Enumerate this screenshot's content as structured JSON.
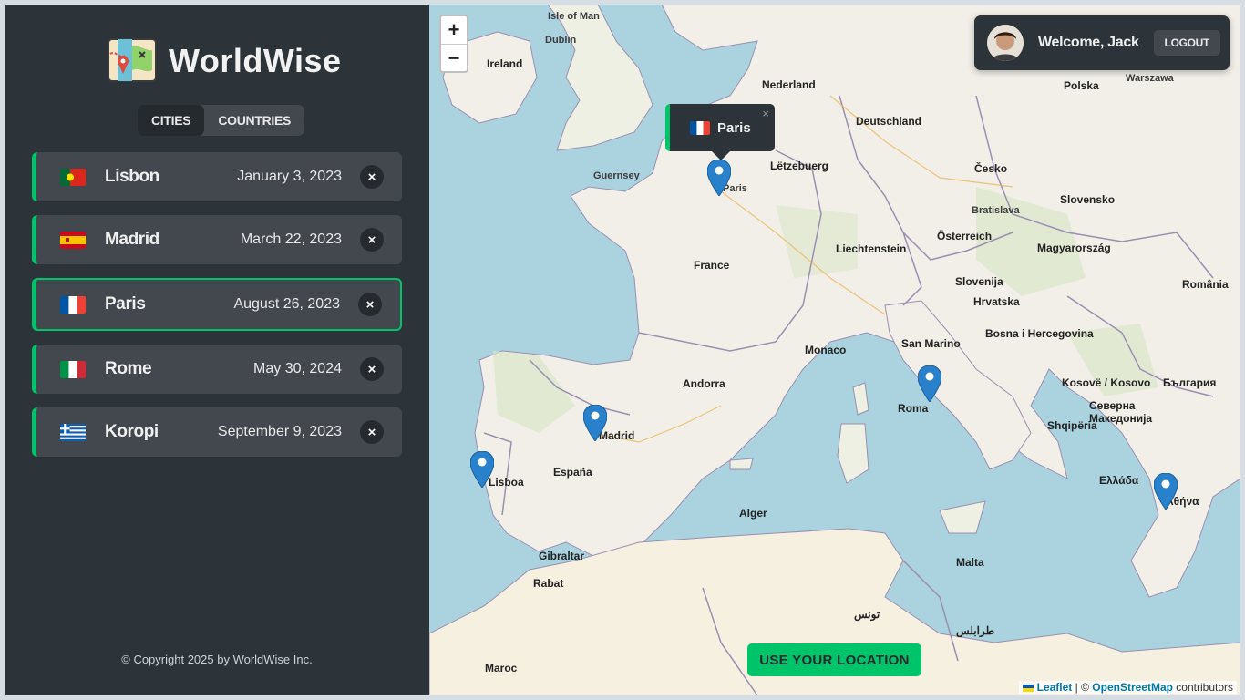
{
  "sidebar": {
    "app_name": "WorldWise",
    "tabs": [
      "CITIES",
      "COUNTRIES"
    ],
    "cities": [
      {
        "name": "Lisbon",
        "date": "January 3, 2023",
        "flag": "portugal",
        "delete": "×"
      },
      {
        "name": "Madrid",
        "date": "March 22, 2023",
        "flag": "spain",
        "delete": "×"
      },
      {
        "name": "Paris",
        "date": "August 26, 2023",
        "flag": "france",
        "delete": "×"
      },
      {
        "name": "Rome",
        "date": "May 30, 2024",
        "flag": "italy",
        "delete": "×"
      },
      {
        "name": "Koropi",
        "date": "September 9, 2023",
        "flag": "greece",
        "delete": "×"
      }
    ],
    "active_city": "Paris",
    "footer": "© Copyright 2025 by WorldWise Inc."
  },
  "map": {
    "zoom_in": "+",
    "zoom_out": "−",
    "user": {
      "welcome": "Welcome, Jack",
      "logout": "LOGOUT"
    },
    "popup": {
      "city": "Paris",
      "close": "×",
      "flag": "france"
    },
    "use_location": "USE YOUR LOCATION",
    "attribution": {
      "leaflet": "Leaflet",
      "separator": " | © ",
      "osm": "OpenStreetMap",
      "suffix": " contributors"
    },
    "labels": [
      "Isle of Man",
      "Dublin",
      "Ireland",
      "Nederland",
      "Deutschland",
      "Polska",
      "Warszawa",
      "Paris",
      "Guernsey",
      "Lëtzebuerg",
      "Česko",
      "Slovensko",
      "Bratislava",
      "Österreich",
      "Magyarország",
      "France",
      "Liechtenstein",
      "Slovenija",
      "Hrvatska",
      "Bosna i Hercegovina",
      "România",
      "Monaco",
      "San Marino",
      "Andorra",
      "Madrid",
      "España",
      "Lisboa",
      "Roma",
      "Kosovë / Kosovo",
      "България",
      "Северна Македонија",
      "Shqipëria",
      "Ελλάδα",
      "Αθήνα",
      "Alger",
      "Gibraltar",
      "Rabat",
      "Malta",
      "Maroc",
      "تونس",
      "طرابلس"
    ],
    "colors": {
      "accent": "#00c46a",
      "panel": "#2d3439",
      "sea": "#aad3df"
    }
  }
}
